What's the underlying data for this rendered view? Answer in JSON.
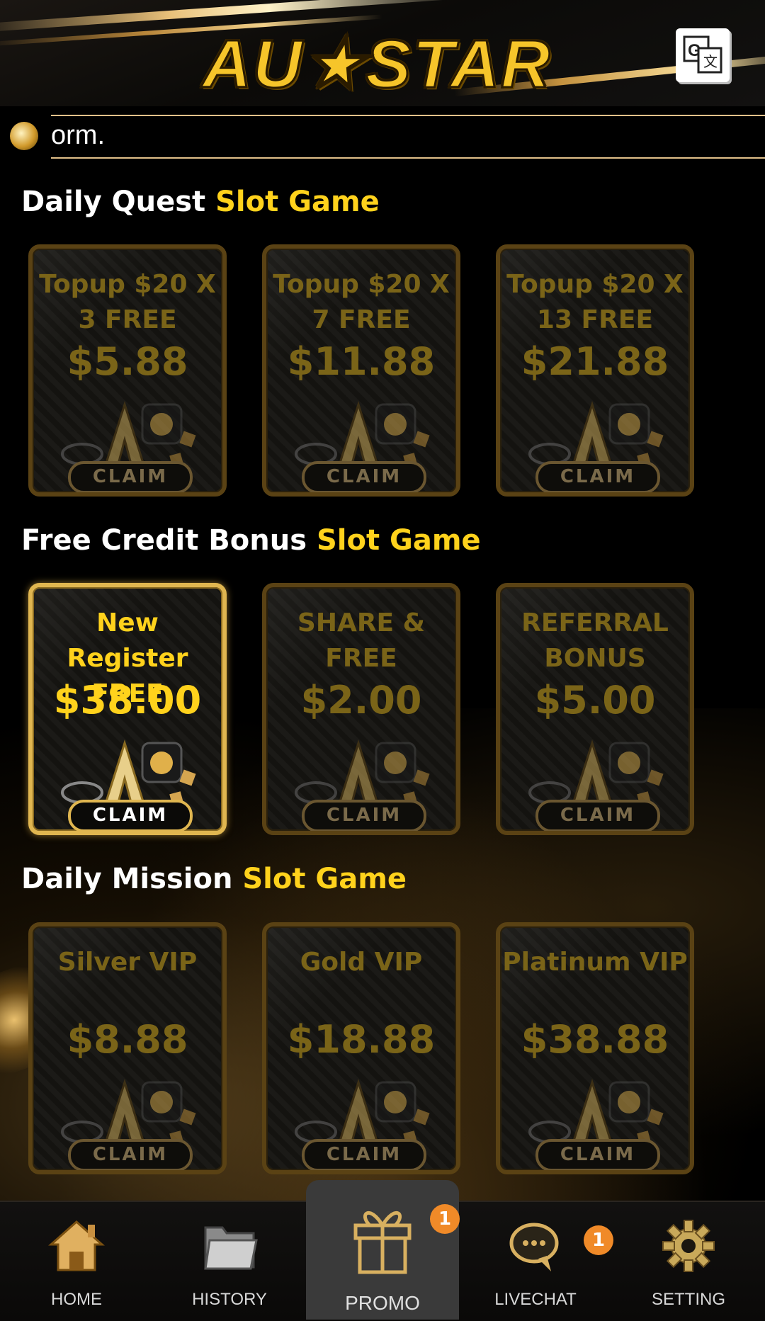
{
  "header": {
    "logo_text": "AU★STAR",
    "translate_icon": "google-translate-icon"
  },
  "marquee": {
    "icon": "speaker-icon",
    "text": "orm."
  },
  "sections": [
    {
      "title_white": "Daily Quest",
      "title_yellow": "Slot Game",
      "cards": [
        {
          "title": "Topup $20 X 3 FREE",
          "amount": "$5.88",
          "claim": "CLAIM",
          "active": false
        },
        {
          "title": "Topup $20 X 7 FREE",
          "amount": "$11.88",
          "claim": "CLAIM",
          "active": false
        },
        {
          "title": "Topup $20 X 13 FREE",
          "amount": "$21.88",
          "claim": "CLAIM",
          "active": false
        }
      ]
    },
    {
      "title_white": "Free Credit Bonus",
      "title_yellow": "Slot Game",
      "cards": [
        {
          "title": "New Register FREE",
          "amount": "$38.00",
          "claim": "CLAIM",
          "active": true
        },
        {
          "title": "SHARE & FREE",
          "amount": "$2.00",
          "claim": "CLAIM",
          "active": false
        },
        {
          "title": "REFERRAL BONUS",
          "amount": "$5.00",
          "claim": "CLAIM",
          "active": false
        }
      ]
    },
    {
      "title_white": "Daily Mission",
      "title_yellow": "Slot Game",
      "cards": [
        {
          "title": "Silver VIP",
          "amount": "$8.88",
          "claim": "CLAIM",
          "active": false
        },
        {
          "title": "Gold VIP",
          "amount": "$18.88",
          "claim": "CLAIM",
          "active": false
        },
        {
          "title": "Platinum VIP",
          "amount": "$38.88",
          "claim": "CLAIM",
          "active": false
        }
      ]
    }
  ],
  "bottom_nav": {
    "items": [
      {
        "label": "HOME",
        "icon": "home-icon"
      },
      {
        "label": "HISTORY",
        "icon": "folder-icon"
      },
      {
        "label": "PROMO",
        "icon": "gift-icon",
        "badge": "1",
        "selected": true
      },
      {
        "label": "LIVECHAT",
        "icon": "chat-icon",
        "badge": "1"
      },
      {
        "label": "SETTING",
        "icon": "gear-icon"
      }
    ]
  },
  "colors": {
    "accent_yellow": "#ffd21c",
    "dim_gold": "#7a6418",
    "badge_orange": "#f08a28"
  }
}
